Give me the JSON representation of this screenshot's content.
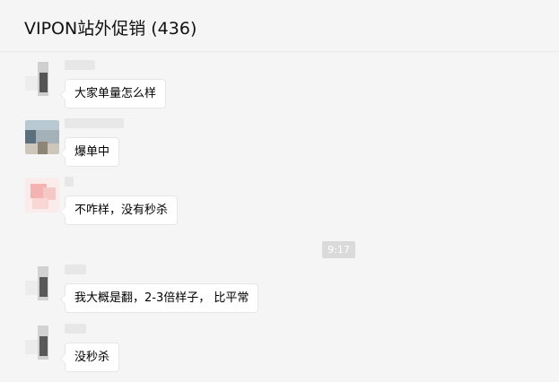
{
  "chat": {
    "title": "VIPON站外促销 (436)"
  },
  "messages": [
    {
      "text": "大家单量怎么样"
    },
    {
      "text": "爆单中"
    },
    {
      "text": "不咋样，没有秒杀"
    },
    {
      "text": "我大概是翻，2-3倍样子， 比平常"
    },
    {
      "text": "没秒杀"
    }
  ],
  "timestamp": "9:17"
}
